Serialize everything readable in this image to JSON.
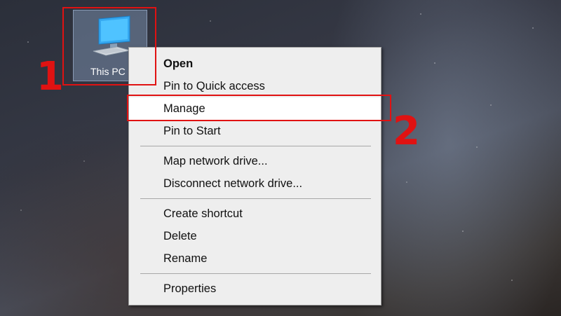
{
  "desktop": {
    "icon_label": "This PC",
    "icon_name": "computer-monitor-icon"
  },
  "annotations": {
    "step1": "1",
    "step2": "2",
    "highlight_color": "#e01212"
  },
  "context_menu": {
    "groups": [
      [
        {
          "label": "Open",
          "bold": true
        },
        {
          "label": "Pin to Quick access"
        },
        {
          "label": "Manage",
          "highlighted": true
        },
        {
          "label": "Pin to Start"
        }
      ],
      [
        {
          "label": "Map network drive..."
        },
        {
          "label": "Disconnect network drive..."
        }
      ],
      [
        {
          "label": "Create shortcut"
        },
        {
          "label": "Delete"
        },
        {
          "label": "Rename"
        }
      ],
      [
        {
          "label": "Properties"
        }
      ]
    ]
  }
}
